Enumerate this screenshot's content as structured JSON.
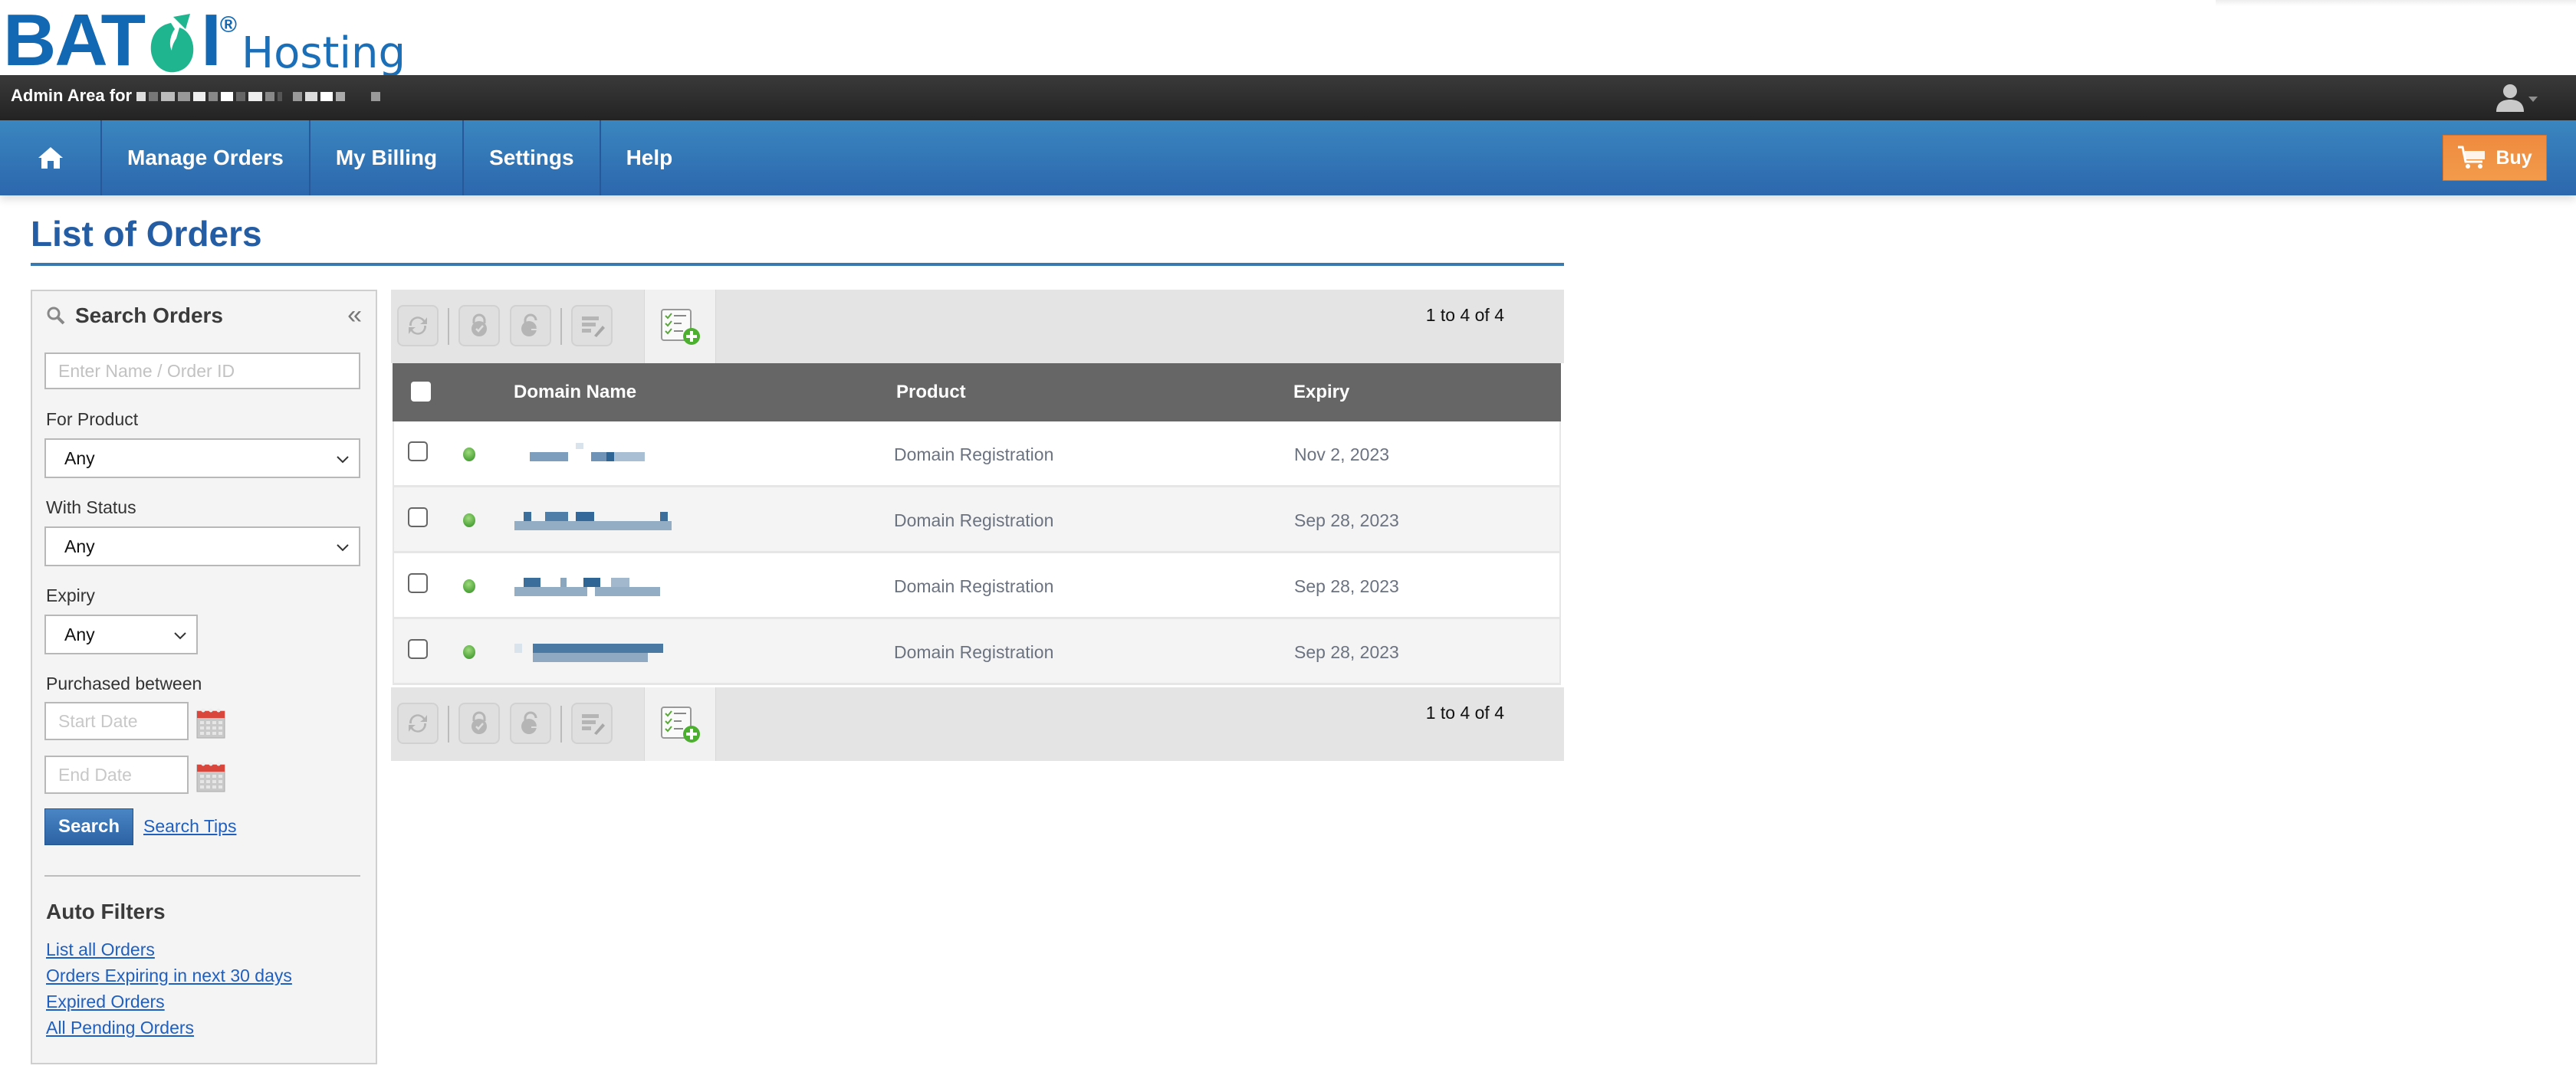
{
  "brand": {
    "logo_word": "BATOI",
    "logo_reg": "®",
    "logo_suffix": "Hosting",
    "primary_color": "#1268b3",
    "leaf_color": "#1fb58f"
  },
  "admin_bar": {
    "label": "Admin Area for",
    "user_menu_icon": "user-icon"
  },
  "nav": {
    "home_icon": "home-icon",
    "items": [
      {
        "label": "Manage Orders"
      },
      {
        "label": "My Billing"
      },
      {
        "label": "Settings"
      },
      {
        "label": "Help"
      }
    ],
    "buy_label": "Buy",
    "buy_color": "#f0903f"
  },
  "page": {
    "title": "List of Orders"
  },
  "sidebar": {
    "title": "Search Orders",
    "collapse_glyph": "«",
    "search_placeholder": "Enter Name / Order ID",
    "for_product_label": "For Product",
    "for_product_value": "Any",
    "status_label": "With Status",
    "status_value": "Any",
    "expiry_label": "Expiry",
    "expiry_value": "Any",
    "purchased_label": "Purchased between",
    "start_placeholder": "Start Date",
    "end_placeholder": "End Date",
    "search_button": "Search",
    "search_tips": "Search Tips",
    "auto_filters_title": "Auto Filters",
    "auto_filters": [
      {
        "label": "List all Orders"
      },
      {
        "label": "Orders Expiring in next 30 days"
      },
      {
        "label": "Expired Orders"
      },
      {
        "label": "All Pending Orders"
      }
    ]
  },
  "toolbar": {
    "count_text": "1 to 4 of 4",
    "buttons": [
      "refresh-icon",
      "lock-approve-icon",
      "unlock-transfer-icon",
      "edit-list-icon"
    ],
    "add_icon": "add-checklist-icon"
  },
  "table": {
    "columns": [
      "Domain Name",
      "Product",
      "Expiry"
    ],
    "rows": [
      {
        "domain": "[redacted]",
        "status": "active",
        "product": "Domain Registration",
        "expiry": "Nov 2, 2023"
      },
      {
        "domain": "[redacted]",
        "status": "active",
        "product": "Domain Registration",
        "expiry": "Sep 28, 2023"
      },
      {
        "domain": "[redacted]",
        "status": "active",
        "product": "Domain Registration",
        "expiry": "Sep 28, 2023"
      },
      {
        "domain": "[redacted]",
        "status": "active",
        "product": "Domain Registration",
        "expiry": "Sep 28, 2023"
      }
    ]
  }
}
